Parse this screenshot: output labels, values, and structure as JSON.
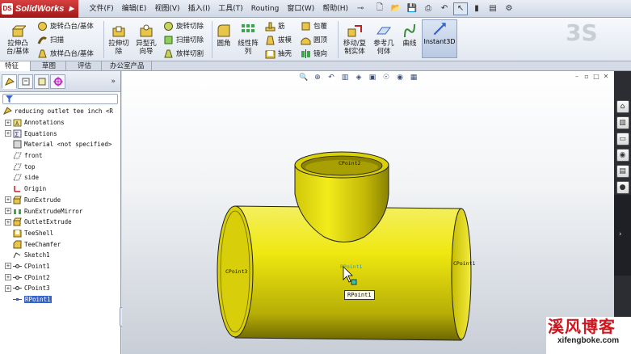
{
  "app": {
    "title": "SolidWorks",
    "logo_mark": "DS"
  },
  "menu": [
    "文件(F)",
    "编辑(E)",
    "视图(V)",
    "插入(I)",
    "工具(T)",
    "Routing",
    "窗口(W)",
    "帮助(H)"
  ],
  "ribbon": {
    "extrude_boss": "拉伸凸\n台/基体",
    "revolve_boss": "旋转凸台/基体",
    "sweep": "扫描",
    "loft": "放样凸台/基体",
    "extrude_cut": "拉伸切\n除",
    "hole_wizard": "异型孔\n向导",
    "revolve_cut": "旋转切除",
    "sweep_cut": "扫描切除",
    "loft_cut": "放样切割",
    "fillet": "圆角",
    "linear_pattern": "线性阵\n列",
    "rib": "筋",
    "draft": "拔模",
    "shell": "抽壳",
    "wrap": "包覆",
    "dome": "圆顶",
    "mirror": "镜向",
    "move_copy": "移动/复\n制实体",
    "ref_geometry": "参考几\n何体",
    "curves": "曲线",
    "instant3d": "Instant3D"
  },
  "tabs": [
    "特征",
    "草图",
    "评估",
    "办公室产品"
  ],
  "tree": {
    "root": "reducing outlet tee inch <R",
    "items": [
      {
        "label": "Annotations",
        "exp": true,
        "icon": "annotations-icon"
      },
      {
        "label": "Equations",
        "exp": true,
        "icon": "equations-icon"
      },
      {
        "label": "Material <not specified>",
        "exp": false,
        "icon": "material-icon"
      },
      {
        "label": "front",
        "exp": false,
        "icon": "plane-icon"
      },
      {
        "label": "top",
        "exp": false,
        "icon": "plane-icon"
      },
      {
        "label": "side",
        "exp": false,
        "icon": "plane-icon"
      },
      {
        "label": "Origin",
        "exp": false,
        "icon": "origin-icon"
      },
      {
        "label": "RunExtrude",
        "exp": true,
        "icon": "extrude-icon"
      },
      {
        "label": "RunExtrudeMirror",
        "exp": true,
        "icon": "mirror-icon"
      },
      {
        "label": "OutletExtrude",
        "exp": true,
        "icon": "extrude-icon"
      },
      {
        "label": "TeeShell",
        "exp": false,
        "icon": "shell-icon"
      },
      {
        "label": "TeeChamfer",
        "exp": false,
        "icon": "chamfer-icon"
      },
      {
        "label": "Sketch1",
        "exp": false,
        "icon": "sketch-icon"
      },
      {
        "label": "CPoint1",
        "exp": true,
        "icon": "cpoint-icon"
      },
      {
        "label": "CPoint2",
        "exp": true,
        "icon": "cpoint-icon"
      },
      {
        "label": "CPoint3",
        "exp": true,
        "icon": "cpoint-icon"
      },
      {
        "label": "RPoint1",
        "exp": false,
        "icon": "rpoint-icon",
        "selected": true
      }
    ]
  },
  "viewport": {
    "labels": [
      "CPoint2",
      "CPoint3",
      "CPoint1",
      "RPoint1"
    ],
    "tooltip": "RPoint1"
  },
  "watermark": {
    "title": "溪风博客",
    "url": "xifengboke.com"
  },
  "colors": {
    "part": "#f0ea10",
    "accent": "#3a63c9",
    "brand": "#c42020"
  }
}
